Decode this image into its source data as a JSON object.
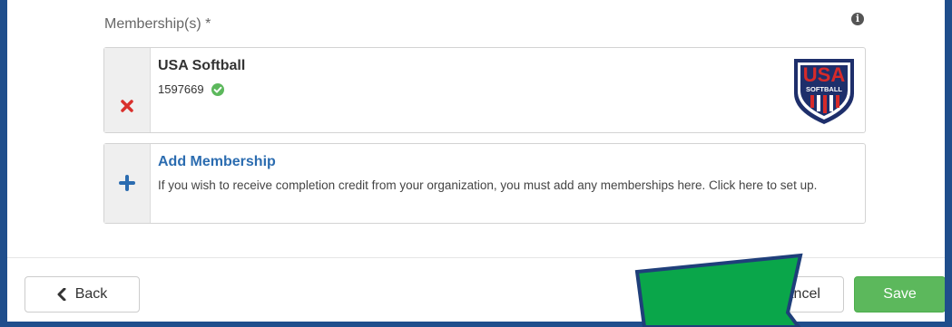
{
  "form": {
    "label": "Membership(s) *",
    "info_icon": "info-circle-icon"
  },
  "membership": {
    "name": "USA Softball",
    "id": "1597669",
    "remove_icon": "x-icon",
    "verified_icon": "check-circle-icon",
    "logo_text": "USA",
    "logo_subtext": "SOFTBALL"
  },
  "add_membership": {
    "title": "Add Membership",
    "description": "If you wish to receive completion credit from your organization, you must add any memberships here. Click here to set up.",
    "icon": "plus-icon"
  },
  "footer": {
    "back_label": "Back",
    "cancel_label": "Cancel",
    "save_label": "Save"
  },
  "colors": {
    "frame": "#1f4e8c",
    "link": "#2b6cb0",
    "save": "#5cb85c",
    "remove": "#d9302c",
    "verified": "#5cb85c",
    "arrow": "#0aa64a"
  }
}
